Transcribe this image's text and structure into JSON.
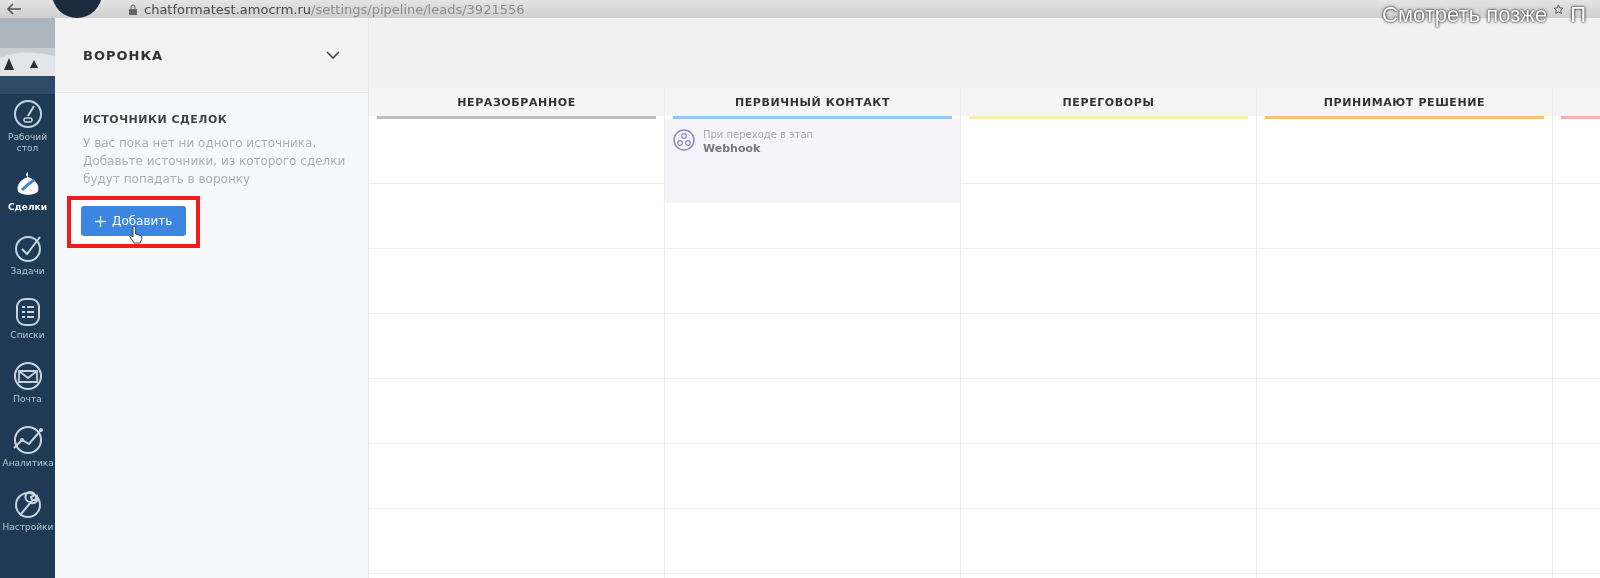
{
  "browser": {
    "url_host": "chatformatest.amocrm.ru",
    "url_path": "/settings/pipeline/leads/3921556"
  },
  "video_overlay": {
    "watch_later": "Смотреть позже",
    "share": "П"
  },
  "nav": [
    {
      "kind": "dashboard",
      "label": "Рабочий стол",
      "selected": false
    },
    {
      "kind": "deals",
      "label": "Сделки",
      "selected": true
    },
    {
      "kind": "tasks",
      "label": "Задачи",
      "selected": false
    },
    {
      "kind": "lists",
      "label": "Списки",
      "selected": false
    },
    {
      "kind": "mail",
      "label": "Почта",
      "selected": false
    },
    {
      "kind": "analytics",
      "label": "Аналитика",
      "selected": false
    },
    {
      "kind": "settings",
      "label": "Настройки",
      "selected": false
    }
  ],
  "panel": {
    "title": "ВОРОНКА",
    "section_title": "ИСТОЧНИКИ СДЕЛОК",
    "empty_text": "У вас пока нет ни одного источника. Добавьте источники, из которого сделки будут попадать в воронку",
    "add_button": "Добавить"
  },
  "stages": [
    {
      "name": "НЕРАЗОБРАННОЕ",
      "color": "#bdbdbd"
    },
    {
      "name": "ПЕРВИЧНЫЙ КОНТАКТ",
      "color": "#99c2f5",
      "triggers": [
        {
          "caption": "При переходе в этап",
          "name": "Webhook"
        }
      ]
    },
    {
      "name": "ПЕРЕГОВОРЫ",
      "color": "#fbeeb0"
    },
    {
      "name": "ПРИНИМАЮТ РЕШЕНИЕ",
      "color": "#f7c27a"
    },
    {
      "color": "#f6b3ad"
    }
  ]
}
